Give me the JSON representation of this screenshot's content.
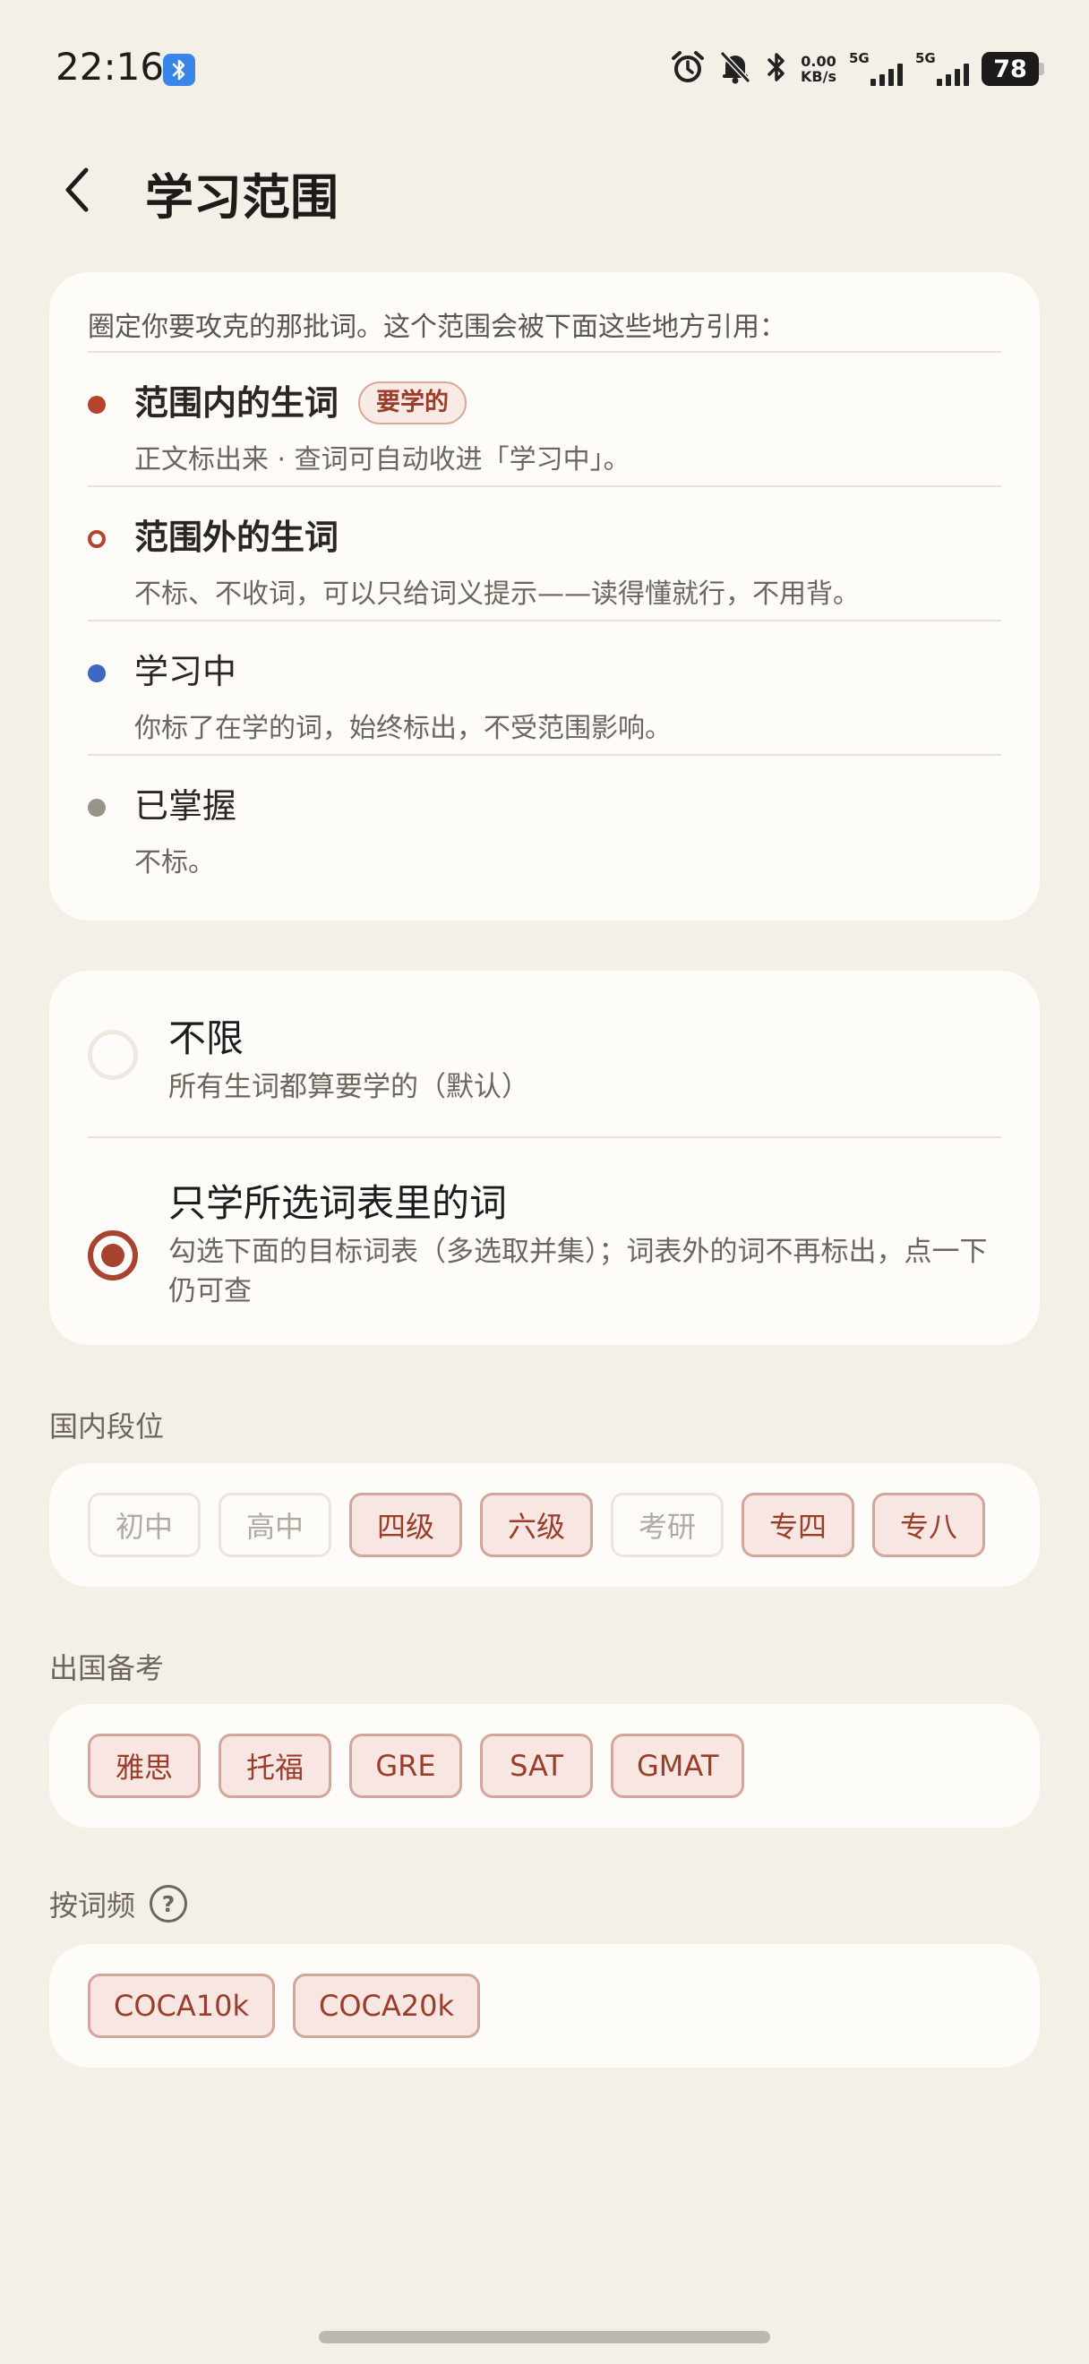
{
  "status_bar": {
    "time": "22:16",
    "net_speed_value": "0.00",
    "net_speed_unit": "KB/s",
    "signal1_label": "5G",
    "signal2_label": "5G",
    "battery": "78"
  },
  "header": {
    "title": "学习范围"
  },
  "legend_card": {
    "intro": "圈定你要攻克的那批词。这个范围会被下面这些地方引用：",
    "items": [
      {
        "title": "范围内的生词",
        "tag": "要学的",
        "desc": "正文标出来 · 查词可自动收进「学习中」。",
        "color": "#B8432D",
        "style": "filled"
      },
      {
        "title": "范围外的生词",
        "desc": "不标、不收词，可以只给词义提示——读得懂就行，不用背。",
        "color": "#B8432D",
        "style": "ring"
      },
      {
        "title": "学习中",
        "desc": "你标了在学的词，始终标出，不受范围影响。",
        "color": "#3E67C4",
        "style": "filled"
      },
      {
        "title": "已掌握",
        "desc": "不标。",
        "color": "#9A938A",
        "style": "filled"
      }
    ]
  },
  "scope_options": [
    {
      "title": "不限",
      "desc": "所有生词都算要学的（默认）",
      "selected": false
    },
    {
      "title": "只学所选词表里的词",
      "desc": "勾选下面的目标词表（多选取并集）；词表外的词不再标出，点一下仍可查",
      "selected": true
    }
  ],
  "groups": {
    "domestic": {
      "label": "国内段位",
      "chips": [
        {
          "label": "初中",
          "selected": false
        },
        {
          "label": "高中",
          "selected": false
        },
        {
          "label": "四级",
          "selected": true
        },
        {
          "label": "六级",
          "selected": true
        },
        {
          "label": "考研",
          "selected": false
        },
        {
          "label": "专四",
          "selected": true
        },
        {
          "label": "专八",
          "selected": true
        }
      ]
    },
    "abroad": {
      "label": "出国备考",
      "chips": [
        {
          "label": "雅思",
          "selected": true
        },
        {
          "label": "托福",
          "selected": true
        },
        {
          "label": "GRE",
          "selected": true
        },
        {
          "label": "SAT",
          "selected": true
        },
        {
          "label": "GMAT",
          "selected": true
        }
      ]
    },
    "frequency": {
      "label": "按词频",
      "help_glyph": "?",
      "chips": [
        {
          "label": "COCA10k",
          "selected": true
        },
        {
          "label": "COCA20k",
          "selected": true
        }
      ]
    }
  }
}
